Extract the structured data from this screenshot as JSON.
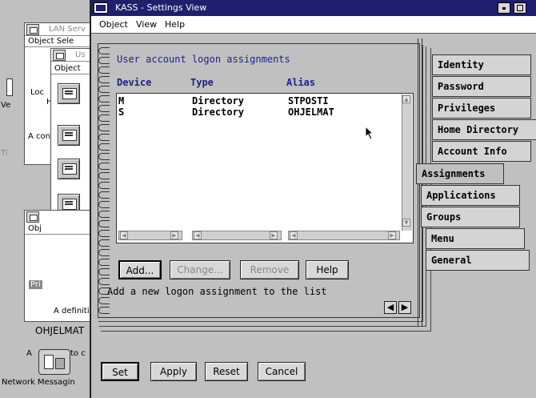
{
  "background_windows": {
    "lan": {
      "title": "LAN Serv",
      "menu": "Object Sele",
      "label_lo": "Loc",
      "label_h": "H",
      "label_v": "Ve",
      "label_ti": "Ti",
      "status": "A con"
    },
    "user": {
      "title": "Us",
      "menu": "Object"
    },
    "third": {
      "menu": "Obj",
      "label_pri": "Pri",
      "status": "A definiti"
    },
    "ohjelmat": {
      "label": "OHJELMAT",
      "status1": "A",
      "status2": "to c"
    },
    "network": {
      "label": "Network Messagin"
    }
  },
  "window": {
    "title": "KASS - Settings View",
    "menu": [
      {
        "label": "Object"
      },
      {
        "label": "View"
      },
      {
        "label": "Help"
      }
    ]
  },
  "page": {
    "heading": "User account logon assignments",
    "columns": [
      "Device",
      "Type",
      "Alias"
    ],
    "rows": [
      {
        "device": "M",
        "type": "Directory",
        "alias": "STPOSTI"
      },
      {
        "device": "S",
        "type": "Directory",
        "alias": "OHJELMAT"
      }
    ],
    "buttons": {
      "add": "Add...",
      "change": "Change...",
      "remove": "Remove",
      "help": "Help"
    },
    "info_text": "Add a new logon assignment to the list"
  },
  "tabs": [
    {
      "label": "Identity"
    },
    {
      "label": "Password"
    },
    {
      "label": "Privileges"
    },
    {
      "label": "Home Directory"
    },
    {
      "label": "Account Info"
    },
    {
      "label": "Assignments"
    },
    {
      "label": "Applications"
    },
    {
      "label": "Groups"
    },
    {
      "label": "Menu"
    },
    {
      "label": "General"
    }
  ],
  "footer": {
    "set": "Set",
    "apply": "Apply",
    "reset": "Reset",
    "cancel": "Cancel"
  },
  "colors": {
    "title_bar": "#1f1f6e",
    "accent_text": "#1f1f8a",
    "face": "#c0c0c0"
  }
}
